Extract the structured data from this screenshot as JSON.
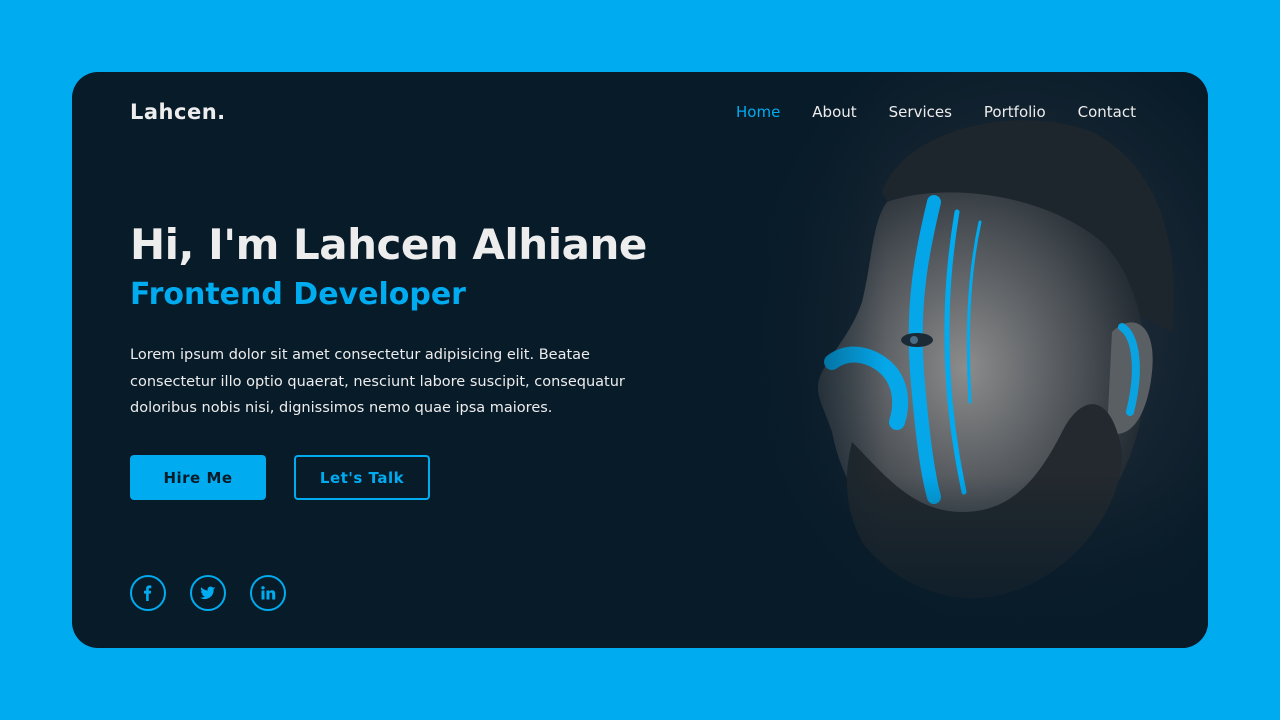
{
  "brand": {
    "logo": "Lahcen."
  },
  "nav": {
    "items": [
      "Home",
      "About",
      "Services",
      "Portfolio",
      "Contact"
    ],
    "active": "Home"
  },
  "hero": {
    "headline": "Hi, I'm Lahcen Alhiane",
    "subhead": "Frontend Developer",
    "bio": "Lorem ipsum dolor sit amet consectetur adipisicing elit. Beatae consectetur illo optio quaerat, nesciunt labore suscipit, consequatur doloribus nobis nisi, dignissimos nemo quae ipsa maiores.",
    "primary_button": "Hire Me",
    "secondary_button": "Let's Talk"
  },
  "socials": [
    {
      "icon": "facebook-icon",
      "glyph": "f"
    },
    {
      "icon": "twitter-icon",
      "glyph": "t"
    },
    {
      "icon": "linkedin-icon",
      "glyph": "in"
    }
  ],
  "colors": {
    "page_background": "#00abf0",
    "card_background": "#081b29",
    "accent": "#00abf0",
    "text": "#ededed"
  },
  "image": {
    "portrait": "man-face-blue-paint"
  }
}
